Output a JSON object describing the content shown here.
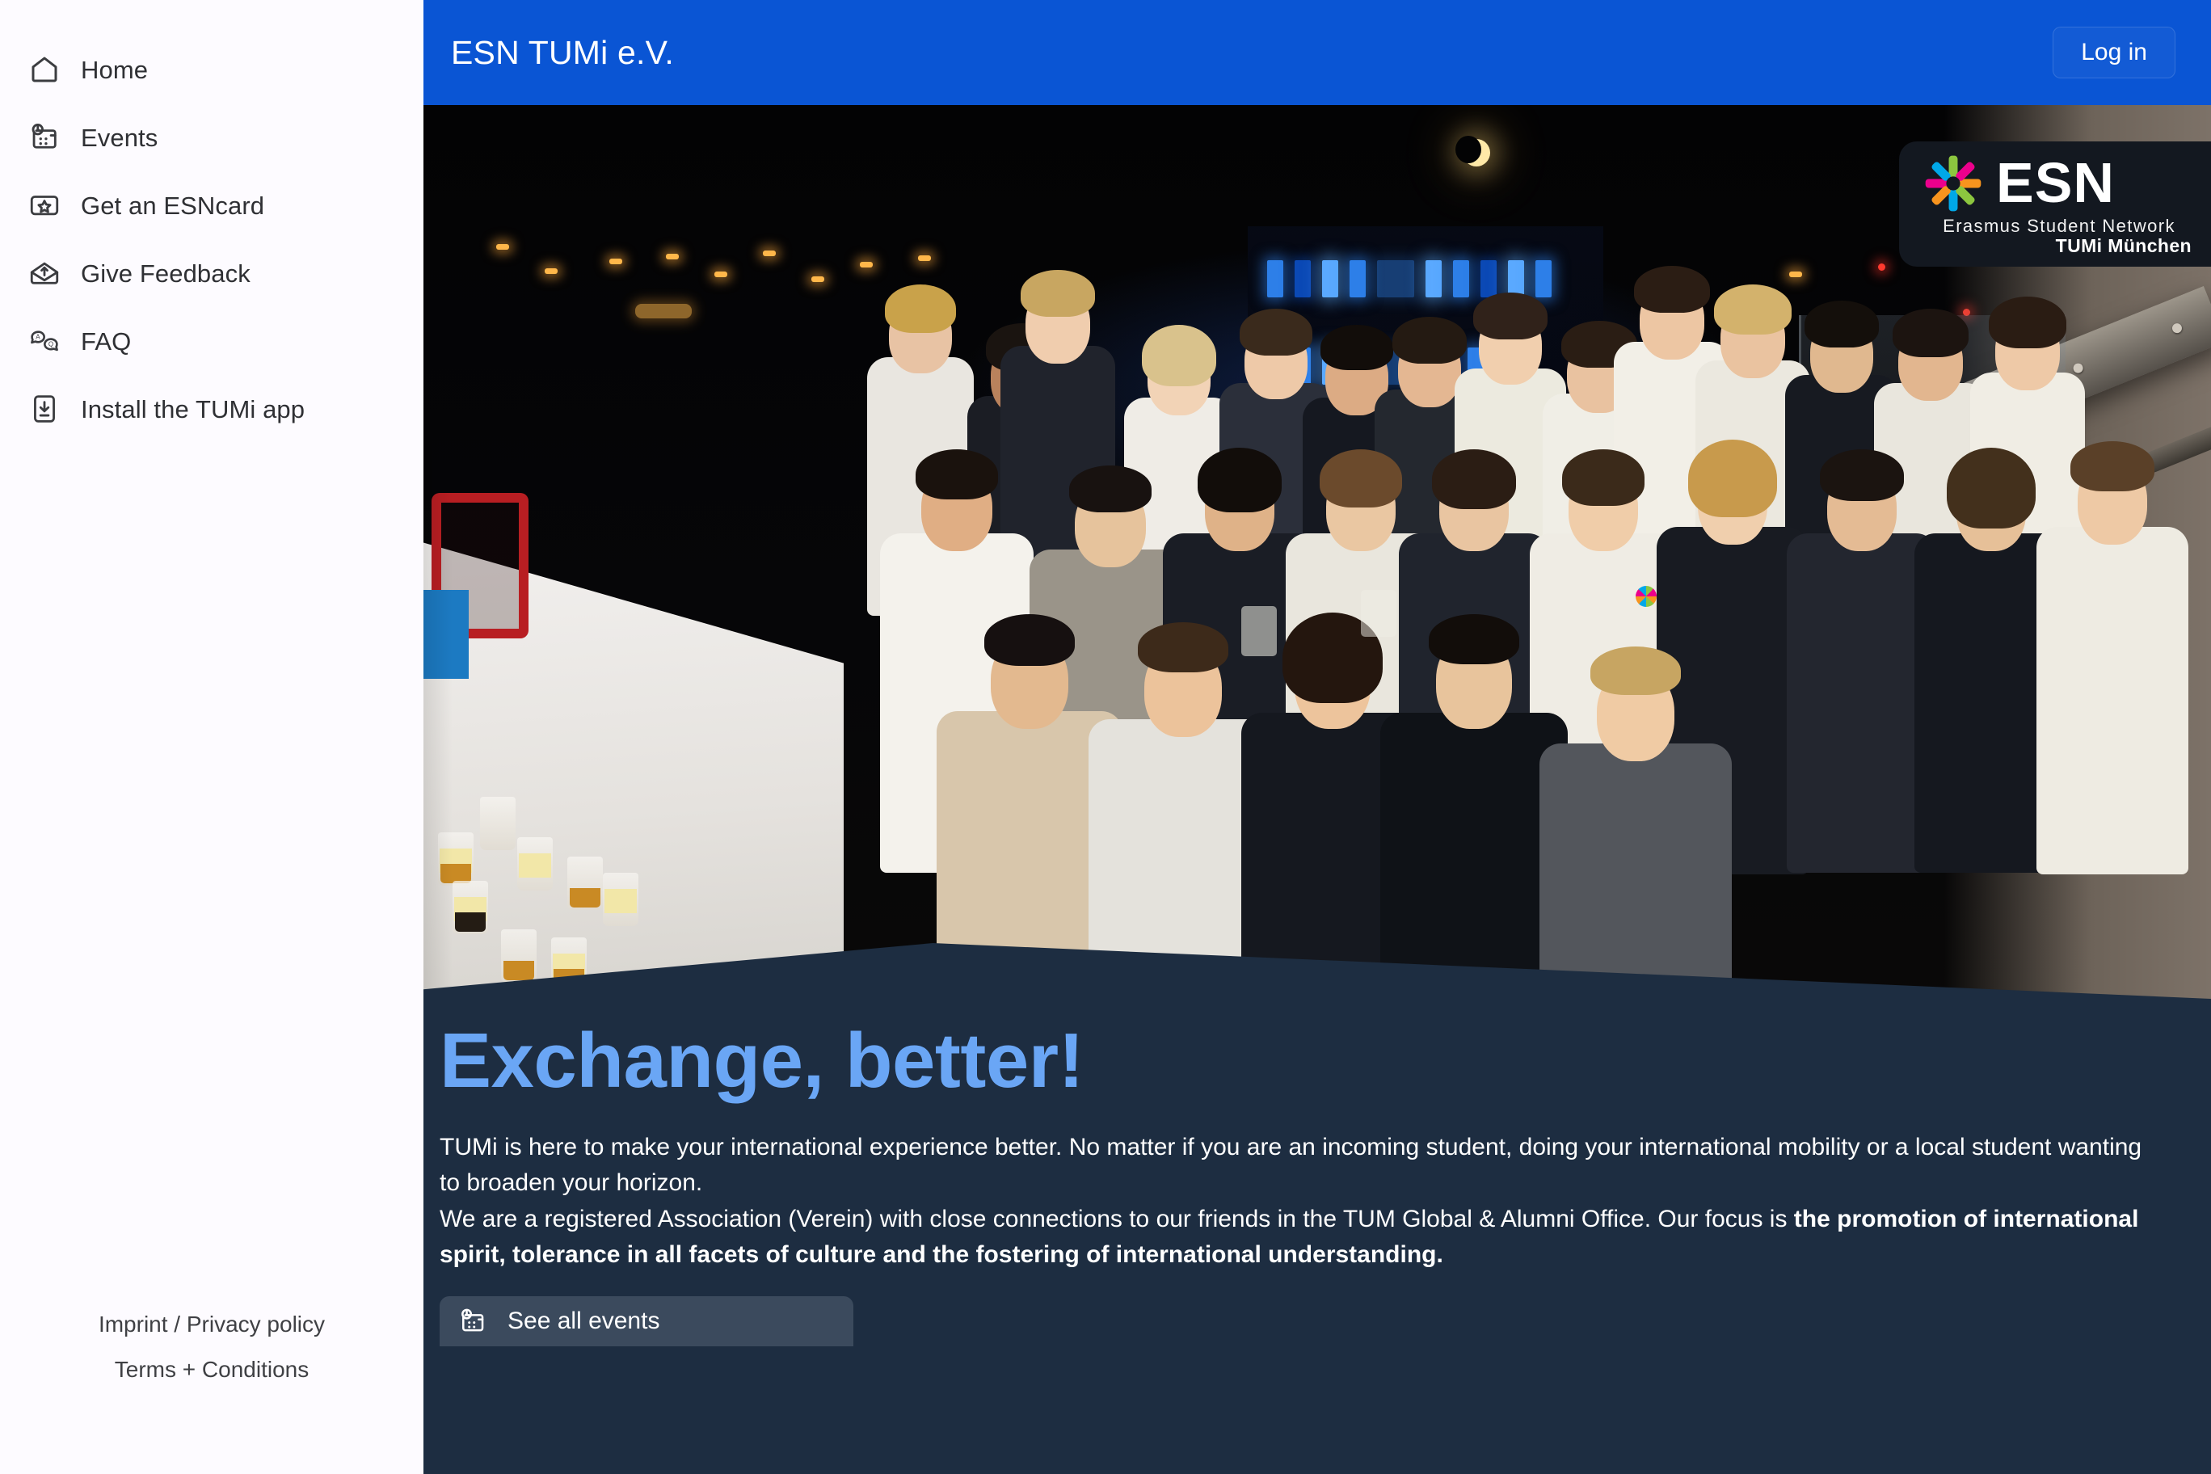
{
  "sidebar": {
    "items": [
      {
        "label": "Home",
        "icon": "home-icon"
      },
      {
        "label": "Events",
        "icon": "events-calendar-clock-icon"
      },
      {
        "label": "Get an ESNcard",
        "icon": "card-star-icon"
      },
      {
        "label": "Give Feedback",
        "icon": "open-envelope-upload-icon"
      },
      {
        "label": "FAQ",
        "icon": "chat-bubbles-qa-icon"
      },
      {
        "label": "Install the TUMi app",
        "icon": "phone-download-icon"
      }
    ],
    "footer": {
      "imprint": "Imprint / Privacy policy",
      "terms": "Terms + Conditions"
    }
  },
  "topbar": {
    "title": "ESN TUMi e.V.",
    "login_label": "Log in",
    "bg_color": "#0a55d4"
  },
  "logo_badge": {
    "wordmark": "ESN",
    "subtitle": "Erasmus Student Network",
    "section": "TUMi München",
    "star_colors": [
      "#8cc63f",
      "#ec008c",
      "#f7941e",
      "#8cc63f",
      "#00a8e8",
      "#f7941e",
      "#ec008c",
      "#00a8e8"
    ],
    "bg_color": "#131820"
  },
  "hero": {
    "title": "Exchange, better!",
    "title_color": "#6aa6f5",
    "panel_color": "#1d2d41",
    "paragraph_1": "TUMi is here to make your international experience better. No matter if you are an incoming student, doing your international mobility or a local student wanting to broaden your horizon.",
    "paragraph_2_lead": "We are a registered Association (Verein) with close connections to our friends in the TUM Global & Alumni Office. Our focus is ",
    "paragraph_2_bold": "the promotion of international spirit, tolerance in all facets of culture and the fostering of international understanding.",
    "cta_label": "See all events",
    "cta_icon": "events-calendar-clock-icon"
  },
  "photo": {
    "description": "Night-time group photo of ESN TUMi members posing on a rooftop terrace in front of a blue-lit building"
  }
}
